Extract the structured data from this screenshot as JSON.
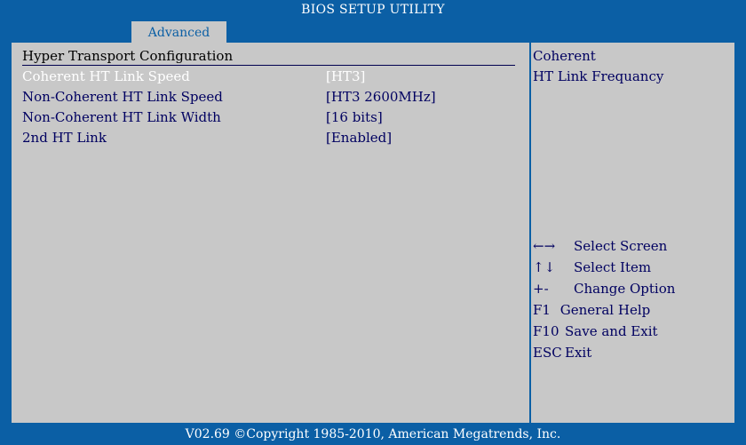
{
  "title": "BIOS SETUP UTILITY",
  "tab": "Advanced",
  "section_title": "Hyper Transport Configuration",
  "settings": [
    {
      "label": "Coherent HT Link Speed",
      "value": "[HT3]"
    },
    {
      "label": "Non-Coherent HT Link Speed",
      "value": "[HT3 2600MHz]"
    },
    {
      "label": "Non-Coherent HT Link Width",
      "value": "[16 bits]"
    },
    {
      "label": "2nd HT Link",
      "value": "[Enabled]"
    }
  ],
  "selected_index": 0,
  "help": {
    "line1": "Coherent",
    "line2": "HT Link Frequancy"
  },
  "keys": [
    {
      "key": "←→",
      "action": "Select Screen"
    },
    {
      "key": "↑↓",
      "action": "Select Item"
    },
    {
      "key": "+-",
      "action": "Change Option"
    },
    {
      "key": "F1",
      "action": "General Help"
    },
    {
      "key": "F10",
      "action": "Save and Exit"
    },
    {
      "key": "ESC",
      "action": "Exit"
    }
  ],
  "footer": "V02.69 ©Copyright 1985-2010, American Megatrends, Inc.",
  "colors": {
    "background": "#0b5fa5",
    "panel": "#c8c8c8",
    "text": "#000060",
    "selected_text": "#ffffff"
  }
}
